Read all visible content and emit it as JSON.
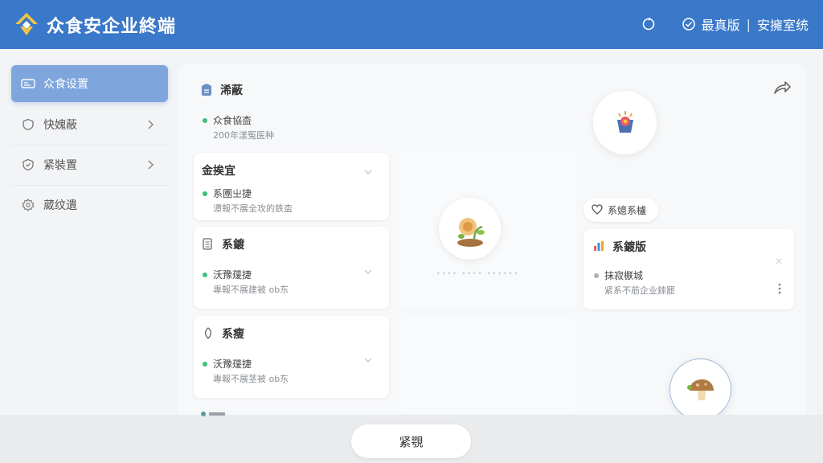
{
  "header": {
    "title": "众食安企业終端",
    "edition": "最真版",
    "separator": "|",
    "system": "安擁室统"
  },
  "sidebar": {
    "items": [
      {
        "label": "众食设置",
        "icon": "settings-card-icon",
        "active": true
      },
      {
        "label": "快媿蔽",
        "icon": "shield-icon",
        "active": false
      },
      {
        "label": "紧裝置",
        "icon": "shield-check-icon",
        "active": false
      },
      {
        "label": "葳纹遺",
        "icon": "gear-icon",
        "active": false
      }
    ]
  },
  "main": {
    "section": {
      "title": "浠蔽",
      "status": "众食協㭗",
      "sub": "200年漾冤医种"
    },
    "cards": [
      {
        "title": "金挨宜",
        "status": "系圑㞢捷",
        "sub": "谭報不展全攻的鉄㭗"
      },
      {
        "title": "系鍍",
        "status": "沃豫蕿捷",
        "sub": "專報不展建被 ob东"
      },
      {
        "title": "系瘦",
        "status": "沃豫蕿捷",
        "sub": "專報不展茎被 ob东"
      }
    ],
    "center_placeholder": "•••• •••• ••••••",
    "chip": {
      "label": "系嬑系櫨",
      "icon": "heart-icon"
    },
    "right_card": {
      "title": "系鍍版",
      "status": "抹寂㮳城",
      "sub": "紧系不荕企业鎍罷"
    }
  },
  "bottom": {
    "button": "紧覨"
  },
  "colors": {
    "header": "#3a78c9",
    "active": "#7ea6dc",
    "status_green": "#3cbf7a"
  }
}
